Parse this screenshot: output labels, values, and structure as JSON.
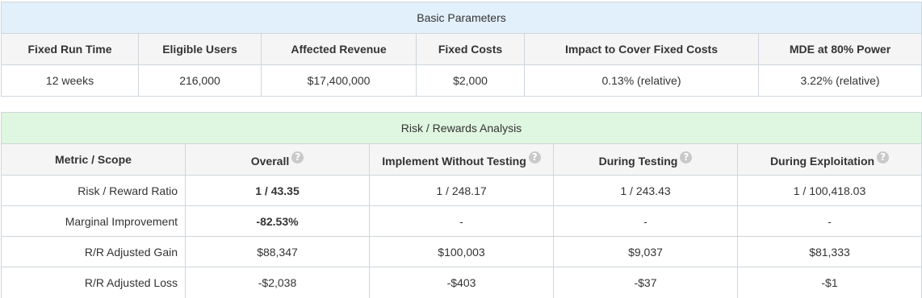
{
  "basic": {
    "title": "Basic Parameters",
    "headers": [
      "Fixed Run Time",
      "Eligible Users",
      "Affected Revenue",
      "Fixed Costs",
      "Impact to Cover Fixed Costs",
      "MDE at 80% Power"
    ],
    "values": [
      "12 weeks",
      "216,000",
      "$17,400,000",
      "$2,000",
      "0.13% (relative)",
      "3.22% (relative)"
    ]
  },
  "risk": {
    "title": "Risk / Rewards Analysis",
    "headers": [
      "Metric / Scope",
      "Overall",
      "Implement Without Testing",
      "During Testing",
      "During Exploitation"
    ],
    "help_glyph": "?",
    "rows": [
      {
        "metric": "Risk / Reward Ratio",
        "overall": "1 / 43.35",
        "implement": "1 / 248.17",
        "testing": "1 / 243.43",
        "exploitation": "1 / 100,418.03"
      },
      {
        "metric": "Marginal Improvement",
        "overall": "-82.53%",
        "implement": "-",
        "testing": "-",
        "exploitation": "-"
      },
      {
        "metric": "R/R Adjusted Gain",
        "overall": "$88,347",
        "implement": "$100,003",
        "testing": "$9,037",
        "exploitation": "$81,333"
      },
      {
        "metric": "R/R Adjusted Loss",
        "overall": "-$2,038",
        "implement": "-$403",
        "testing": "-$37",
        "exploitation": "-$1"
      }
    ]
  },
  "colors": {
    "basic_title_bg": "#e2f0fb",
    "risk_title_bg": "#dff6e0",
    "header_bg": "#f5f5f5",
    "negative_text": "#d32f2f",
    "help_icon_bg": "#c9c9c9",
    "border": "#cfd6dc"
  }
}
